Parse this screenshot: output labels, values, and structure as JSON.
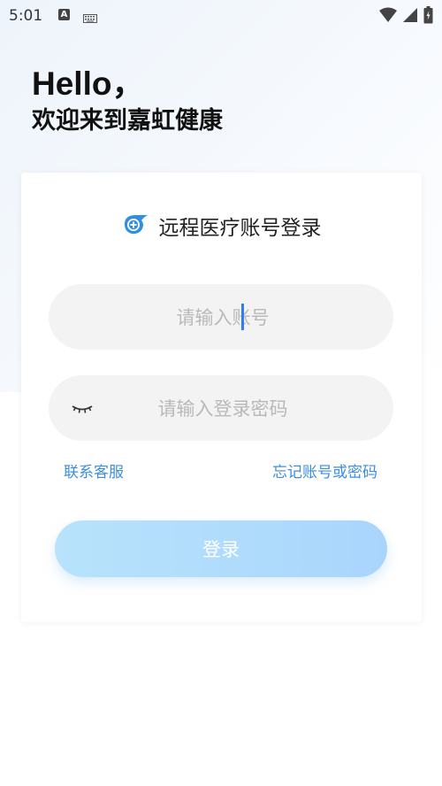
{
  "status_bar": {
    "time": "5:01",
    "notification_a": "A",
    "icons": [
      "keyboard-icon",
      "wifi-icon",
      "signal-icon",
      "battery-icon"
    ]
  },
  "greeting": {
    "hello": "Hello，",
    "welcome": "欢迎来到嘉虹健康"
  },
  "login_card": {
    "title": "远程医疗账号登录",
    "logo_icon": "app-logo-icon",
    "account_placeholder": "请输入账号",
    "password_placeholder": "请输入登录密码",
    "eye_icon": "eye-closed-icon",
    "contact_service": "联系客服",
    "forgot": "忘记账号或密码",
    "login_button": "登录"
  },
  "colors": {
    "link": "#3c8de0",
    "button_gradient_start": "#b8e3fb",
    "button_gradient_end": "#a9d5fd",
    "field_bg": "#f3f3f3",
    "caret": "#2f7ff2"
  }
}
